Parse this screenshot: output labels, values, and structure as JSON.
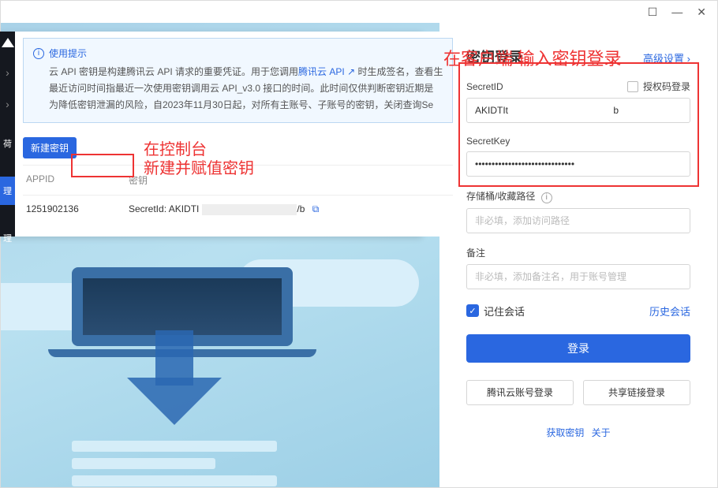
{
  "titlebar": {
    "mobile_icon": "☐",
    "minimize": "—",
    "close": "✕"
  },
  "console": {
    "sidebar": {
      "triangle": "",
      "arrows": [
        "›",
        "›"
      ],
      "items": [
        "荷",
        "理",
        "理"
      ],
      "active_index": 1
    },
    "tip": {
      "heading": "使用提示",
      "bullets": [
        {
          "pre": "云 API 密钥是构建腾讯云 API 请求的重要凭证。用于您调用",
          "link": "腾讯云 API",
          "link_icon": "↗",
          "post": " 时生成签名，查看生"
        },
        {
          "text": "最近访问时间指最近一次使用密钥调用云 API_v3.0 接口的时间。此时间仅供判断密钥近期是"
        },
        {
          "text": "为降低密钥泄漏的风险，自2023年11月30日起，对所有主账号、子账号的密钥，关闭查询Se"
        }
      ]
    },
    "new_key_btn": "新建密钥",
    "table": {
      "headers": [
        "APPID",
        "密钥"
      ],
      "row": {
        "appid": "1251902136",
        "secret_label": "SecretId:",
        "secret_prefix": "AKIDTI",
        "secret_suffix": "/b"
      }
    }
  },
  "annotations": {
    "console_line1": "在控制台",
    "console_line2": "新建并赋值密钥",
    "login_line": "在客户端 输入密钥登录"
  },
  "login": {
    "title": "密钥登录",
    "adv_settings": "高级设置 ›",
    "secret_id_label": "SecretID",
    "auth_code_label": "授权码登录",
    "secret_id_value": "AKIDTIt                                        b",
    "secret_key_label": "SecretKey",
    "secret_key_value": "••••••••••••••••••••••••••••••",
    "bucket_label": "存储桶/收藏路径",
    "bucket_placeholder": "非必填，添加访问路径",
    "remark_label": "备注",
    "remark_placeholder": "非必填，添加备注名，用于账号管理",
    "remember_label": "记住会话",
    "history_label": "历史会话",
    "login_btn": "登录",
    "alt1": "腾讯云账号登录",
    "alt2": "共享链接登录",
    "footer1": "获取密钥",
    "footer2": "关于"
  }
}
